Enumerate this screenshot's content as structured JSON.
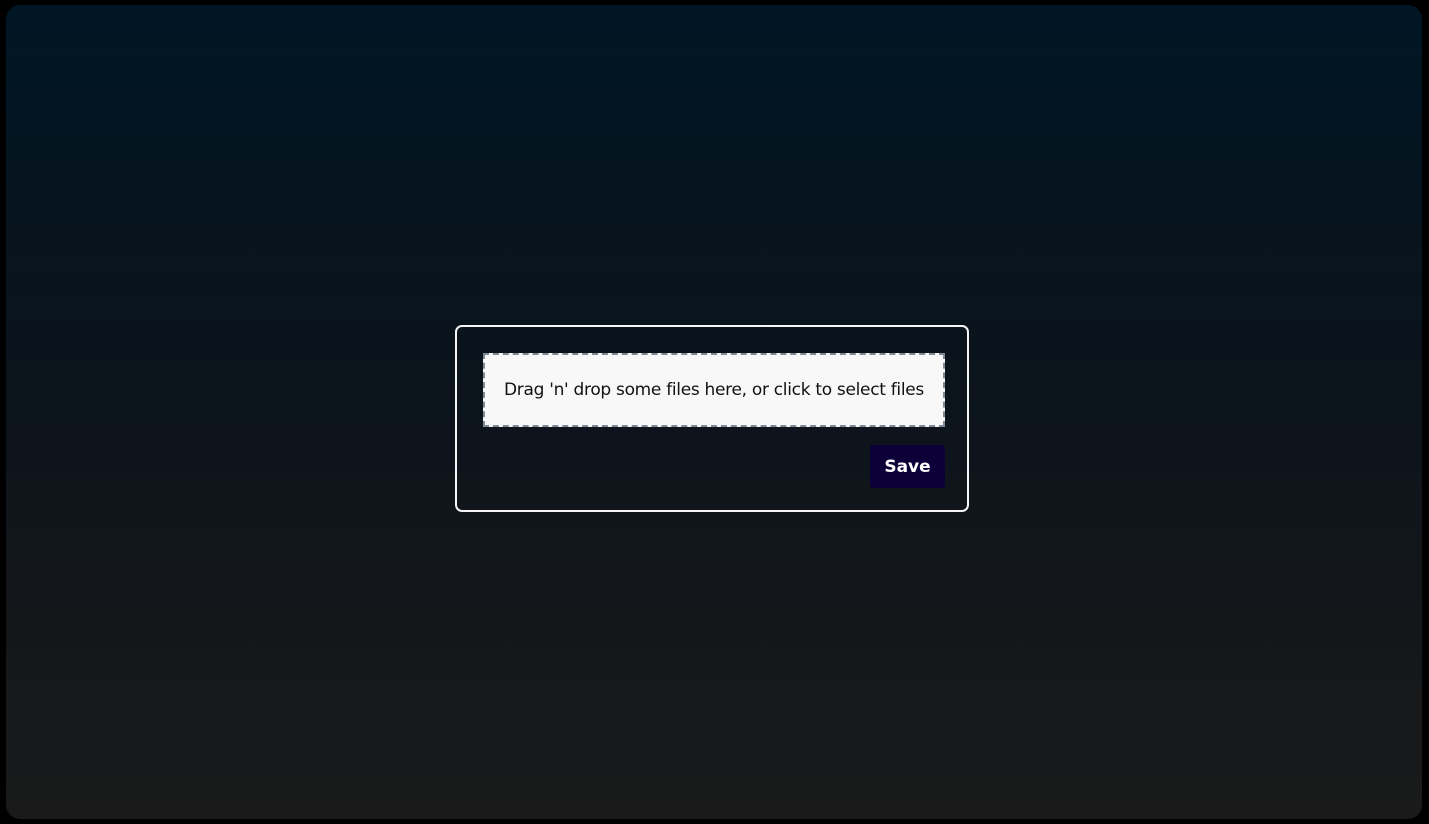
{
  "upload": {
    "dropzone_text": "Drag 'n' drop some files here, or click to select files",
    "save_label": "Save"
  },
  "colors": {
    "save_button_bg": "#0c0039",
    "dropzone_bg": "#f8f8f8",
    "card_border": "#f5f5f5"
  }
}
